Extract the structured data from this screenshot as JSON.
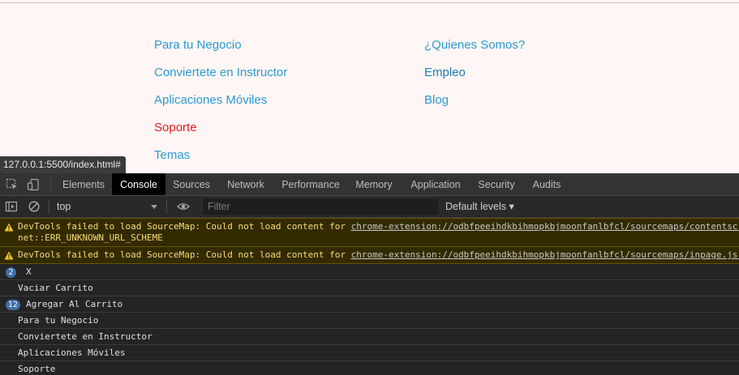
{
  "page": {
    "footer_left": [
      {
        "label": "Para tu Negocio"
      },
      {
        "label": "Conviertete en Instructor"
      },
      {
        "label": "Aplicaciones Móviles"
      },
      {
        "label": "Soporte"
      },
      {
        "label": "Temas"
      }
    ],
    "footer_right": [
      {
        "label": "¿Quienes Somos?"
      },
      {
        "label": "Empleo"
      },
      {
        "label": "Blog"
      }
    ],
    "status_url": "127.0.0.1:5500/index.html#"
  },
  "devtools": {
    "tabs": [
      {
        "label": "Elements"
      },
      {
        "label": "Console"
      },
      {
        "label": "Sources"
      },
      {
        "label": "Network"
      },
      {
        "label": "Performance"
      },
      {
        "label": "Memory"
      },
      {
        "label": "Application"
      },
      {
        "label": "Security"
      },
      {
        "label": "Audits"
      }
    ],
    "active_tab": "Console",
    "toolbar": {
      "context": "top",
      "filter_placeholder": "Filter",
      "levels": "Default levels ▾"
    },
    "messages": [
      {
        "type": "warning",
        "text": "DevTools failed to load SourceMap: Could not load content for ",
        "link": "chrome-extension://odbfpeeihdkbihmopkbjmoonfanlbfcl/sourcemaps/contentscr",
        "text2": "net::ERR_UNKNOWN_URL_SCHEME"
      },
      {
        "type": "warning",
        "text": "DevTools failed to load SourceMap: Could not load content for ",
        "link": "chrome-extension://odbfpeeihdkbihmopkbjmoonfanlbfcl/sourcemaps/inpage.js."
      },
      {
        "type": "log",
        "count": "2",
        "text": "X"
      },
      {
        "type": "log",
        "text": "Vaciar Carrito"
      },
      {
        "type": "log",
        "count": "12",
        "text": "Agregar Al Carrito"
      },
      {
        "type": "log",
        "text": "Para tu Negocio"
      },
      {
        "type": "log",
        "text": "Conviertete en Instructor"
      },
      {
        "type": "log",
        "text": "Aplicaciones Móviles"
      },
      {
        "type": "log",
        "text": "Soporte"
      }
    ],
    "colors": {
      "link_blue": "#2a9bd0",
      "link_hover_red": "#e01e1e",
      "warning_bg": "#332b00",
      "warning_text": "#f7dc7b",
      "count_badge": "#3f6ea8"
    }
  }
}
